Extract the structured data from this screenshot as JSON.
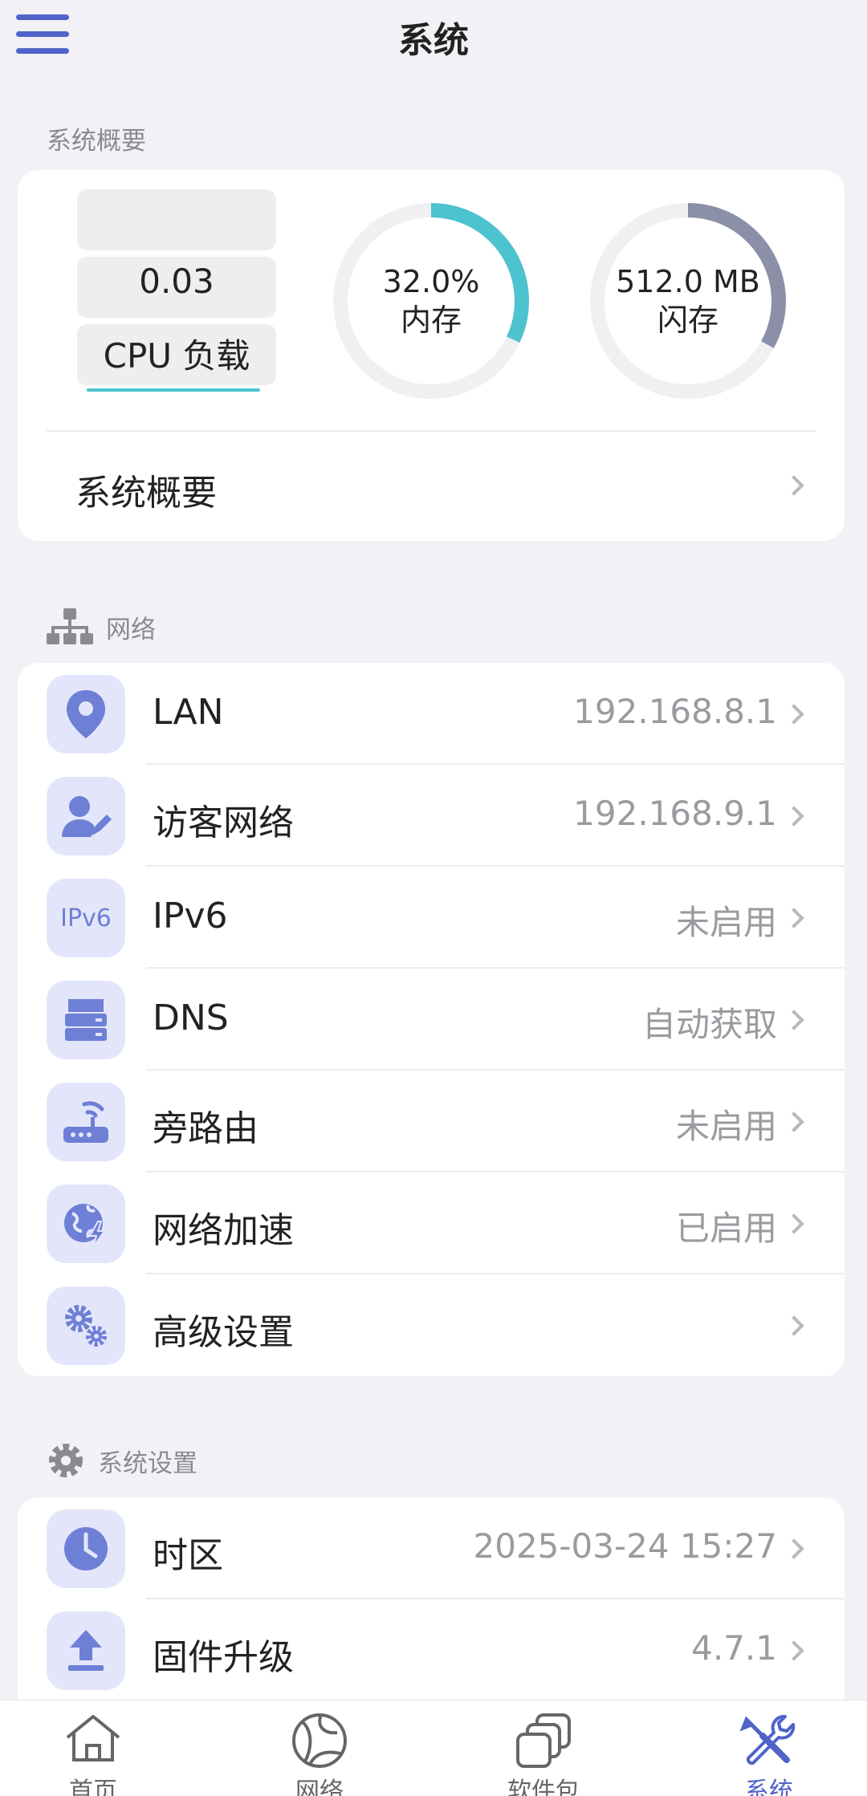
{
  "header": {
    "title": "系统"
  },
  "overview": {
    "section_title": "系统概要",
    "cpu": {
      "value": "0.03",
      "label": "CPU 负载"
    },
    "memory": {
      "value": "32.0%",
      "label": "内存",
      "fraction": 0.32
    },
    "flash": {
      "value": "512.0 MB",
      "label": "闪存",
      "fraction": 0.33
    },
    "link_label": "系统概要"
  },
  "network": {
    "section_title": "网络",
    "items": [
      {
        "label": "LAN",
        "value": "192.168.8.1",
        "icon": "location-pin-icon"
      },
      {
        "label": "访客网络",
        "value": "192.168.9.1",
        "icon": "guest-user-icon"
      },
      {
        "label": "IPv6",
        "value": "未启用",
        "icon": "ipv6-icon",
        "icon_text": "IPv6"
      },
      {
        "label": "DNS",
        "value": "自动获取",
        "icon": "server-icon"
      },
      {
        "label": "旁路由",
        "value": "未启用",
        "icon": "router-icon"
      },
      {
        "label": "网络加速",
        "value": "已启用",
        "icon": "globe-bolt-icon"
      },
      {
        "label": "高级设置",
        "value": "",
        "icon": "gears-icon"
      }
    ]
  },
  "system_settings": {
    "section_title": "系统设置",
    "items": [
      {
        "label": "时区",
        "value": "2025-03-24 15:27",
        "icon": "clock-icon"
      },
      {
        "label": "固件升级",
        "value": "4.7.1",
        "icon": "upload-icon"
      }
    ]
  },
  "bottom_nav": {
    "items": [
      {
        "label": "首页",
        "icon": "home-icon"
      },
      {
        "label": "网络",
        "icon": "globe-icon"
      },
      {
        "label": "软件包",
        "icon": "packages-icon"
      },
      {
        "label": "系统",
        "icon": "tools-icon"
      }
    ],
    "active_index": 3
  },
  "colors": {
    "accent": "#4f63c9",
    "memory_ring": "#4cc3cf",
    "flash_ring": "#8b90a8",
    "icon_bg": "#e3e6fa",
    "icon_fg": "#6e7fd6"
  }
}
